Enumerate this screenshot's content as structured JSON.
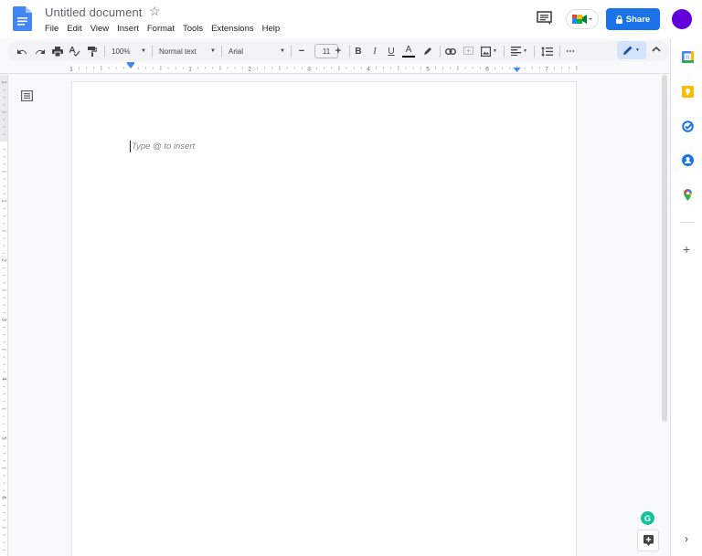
{
  "header": {
    "doc_title": "Untitled document",
    "menu": [
      "File",
      "Edit",
      "View",
      "Insert",
      "Format",
      "Tools",
      "Extensions",
      "Help"
    ],
    "share_label": "Share",
    "avatar_color": "#6200d9",
    "share_color": "#1a73e8"
  },
  "toolbar": {
    "zoom": "100%",
    "style": "Normal text",
    "font": "Arial",
    "font_size": "11",
    "minus": "−",
    "plus": "+",
    "more": "⋯"
  },
  "ruler": {
    "h_labels": [
      "1",
      "1",
      "2",
      "3",
      "4",
      "5",
      "6",
      "7"
    ],
    "v_labels": [
      "1",
      "1",
      "2",
      "3",
      "4",
      "5",
      "6"
    ]
  },
  "document": {
    "placeholder": "Type @ to insert"
  },
  "side_panel": {
    "apps": [
      "calendar",
      "keep",
      "tasks",
      "contacts",
      "maps"
    ],
    "add": "+",
    "expand": "›"
  },
  "grammarly": "G"
}
